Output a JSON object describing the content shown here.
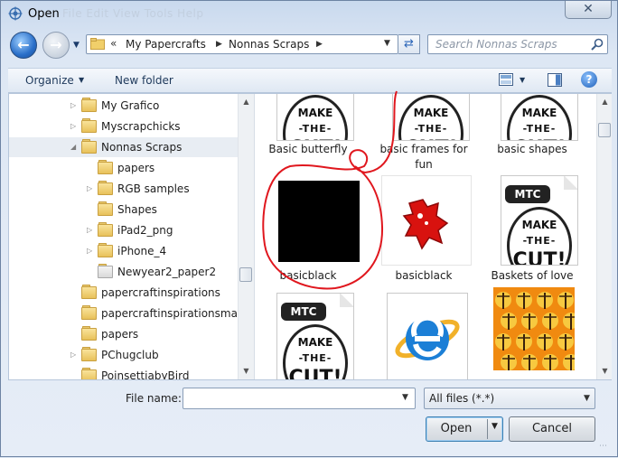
{
  "window": {
    "title": "Open",
    "ghost_menu": "File  Edit  View  Tools  Help",
    "close_glyph": "✕"
  },
  "nav": {
    "address": {
      "chevrons": "«",
      "crumbs": [
        "My Papercrafts",
        "Nonnas Scraps"
      ]
    },
    "search": {
      "placeholder": "Search Nonnas Scraps"
    }
  },
  "toolbar": {
    "organize": "Organize",
    "new_folder": "New folder",
    "help_glyph": "?"
  },
  "tree": [
    {
      "label": "My Grafico",
      "expand": "▷",
      "indent": 0,
      "icon": "folder"
    },
    {
      "label": "Myscrapchicks",
      "expand": "▷",
      "indent": 0,
      "icon": "folder"
    },
    {
      "label": "Nonnas Scraps",
      "expand": "◢",
      "indent": 0,
      "icon": "folder",
      "selected": true
    },
    {
      "label": "papers",
      "expand": "",
      "indent": 1,
      "icon": "folder"
    },
    {
      "label": "RGB samples",
      "expand": "▷",
      "indent": 1,
      "icon": "folder"
    },
    {
      "label": "Shapes",
      "expand": "",
      "indent": 1,
      "icon": "folder"
    },
    {
      "label": "iPad2_png",
      "expand": "▷",
      "indent": 1,
      "icon": "folder"
    },
    {
      "label": "iPhone_4",
      "expand": "▷",
      "indent": 1,
      "icon": "folder"
    },
    {
      "label": "Newyear2_paper2",
      "expand": "",
      "indent": 1,
      "icon": "paper"
    },
    {
      "label": "papercraftinspirations",
      "expand": "",
      "indent": 0,
      "icon": "folder"
    },
    {
      "label": "papercraftinspirationsmag",
      "expand": "",
      "indent": 0,
      "icon": "folder"
    },
    {
      "label": "papers",
      "expand": "",
      "indent": 0,
      "icon": "folder"
    },
    {
      "label": "PChugclub",
      "expand": "▷",
      "indent": 0,
      "icon": "folder"
    },
    {
      "label": "PoinsettiabyBird",
      "expand": "",
      "indent": 0,
      "icon": "folder"
    }
  ],
  "files": [
    {
      "label": "Basic butterfly",
      "kind": "mtc"
    },
    {
      "label": "basic frames for fun",
      "kind": "mtc"
    },
    {
      "label": "basic shapes",
      "kind": "mtc"
    },
    {
      "label": "basicblack",
      "kind": "black"
    },
    {
      "label": "basicblack",
      "kind": "redpaw"
    },
    {
      "label": "Baskets of love",
      "kind": "mtc"
    },
    {
      "label": "",
      "kind": "mtc"
    },
    {
      "label": "",
      "kind": "ie"
    },
    {
      "label": "",
      "kind": "pattern"
    }
  ],
  "mtc_art": {
    "tag": "MTC",
    "w1": "MAKE",
    "w2": "-THE-",
    "w3": "CUT!"
  },
  "bottom": {
    "file_name_label": "File name:",
    "file_name_value": "",
    "filter": "All files (*.*)",
    "open": "Open",
    "cancel": "Cancel"
  },
  "colors": {
    "annotation": "#e0171e",
    "ie_blue": "#1c7fd6",
    "pattern_orange": "#f08a10"
  }
}
